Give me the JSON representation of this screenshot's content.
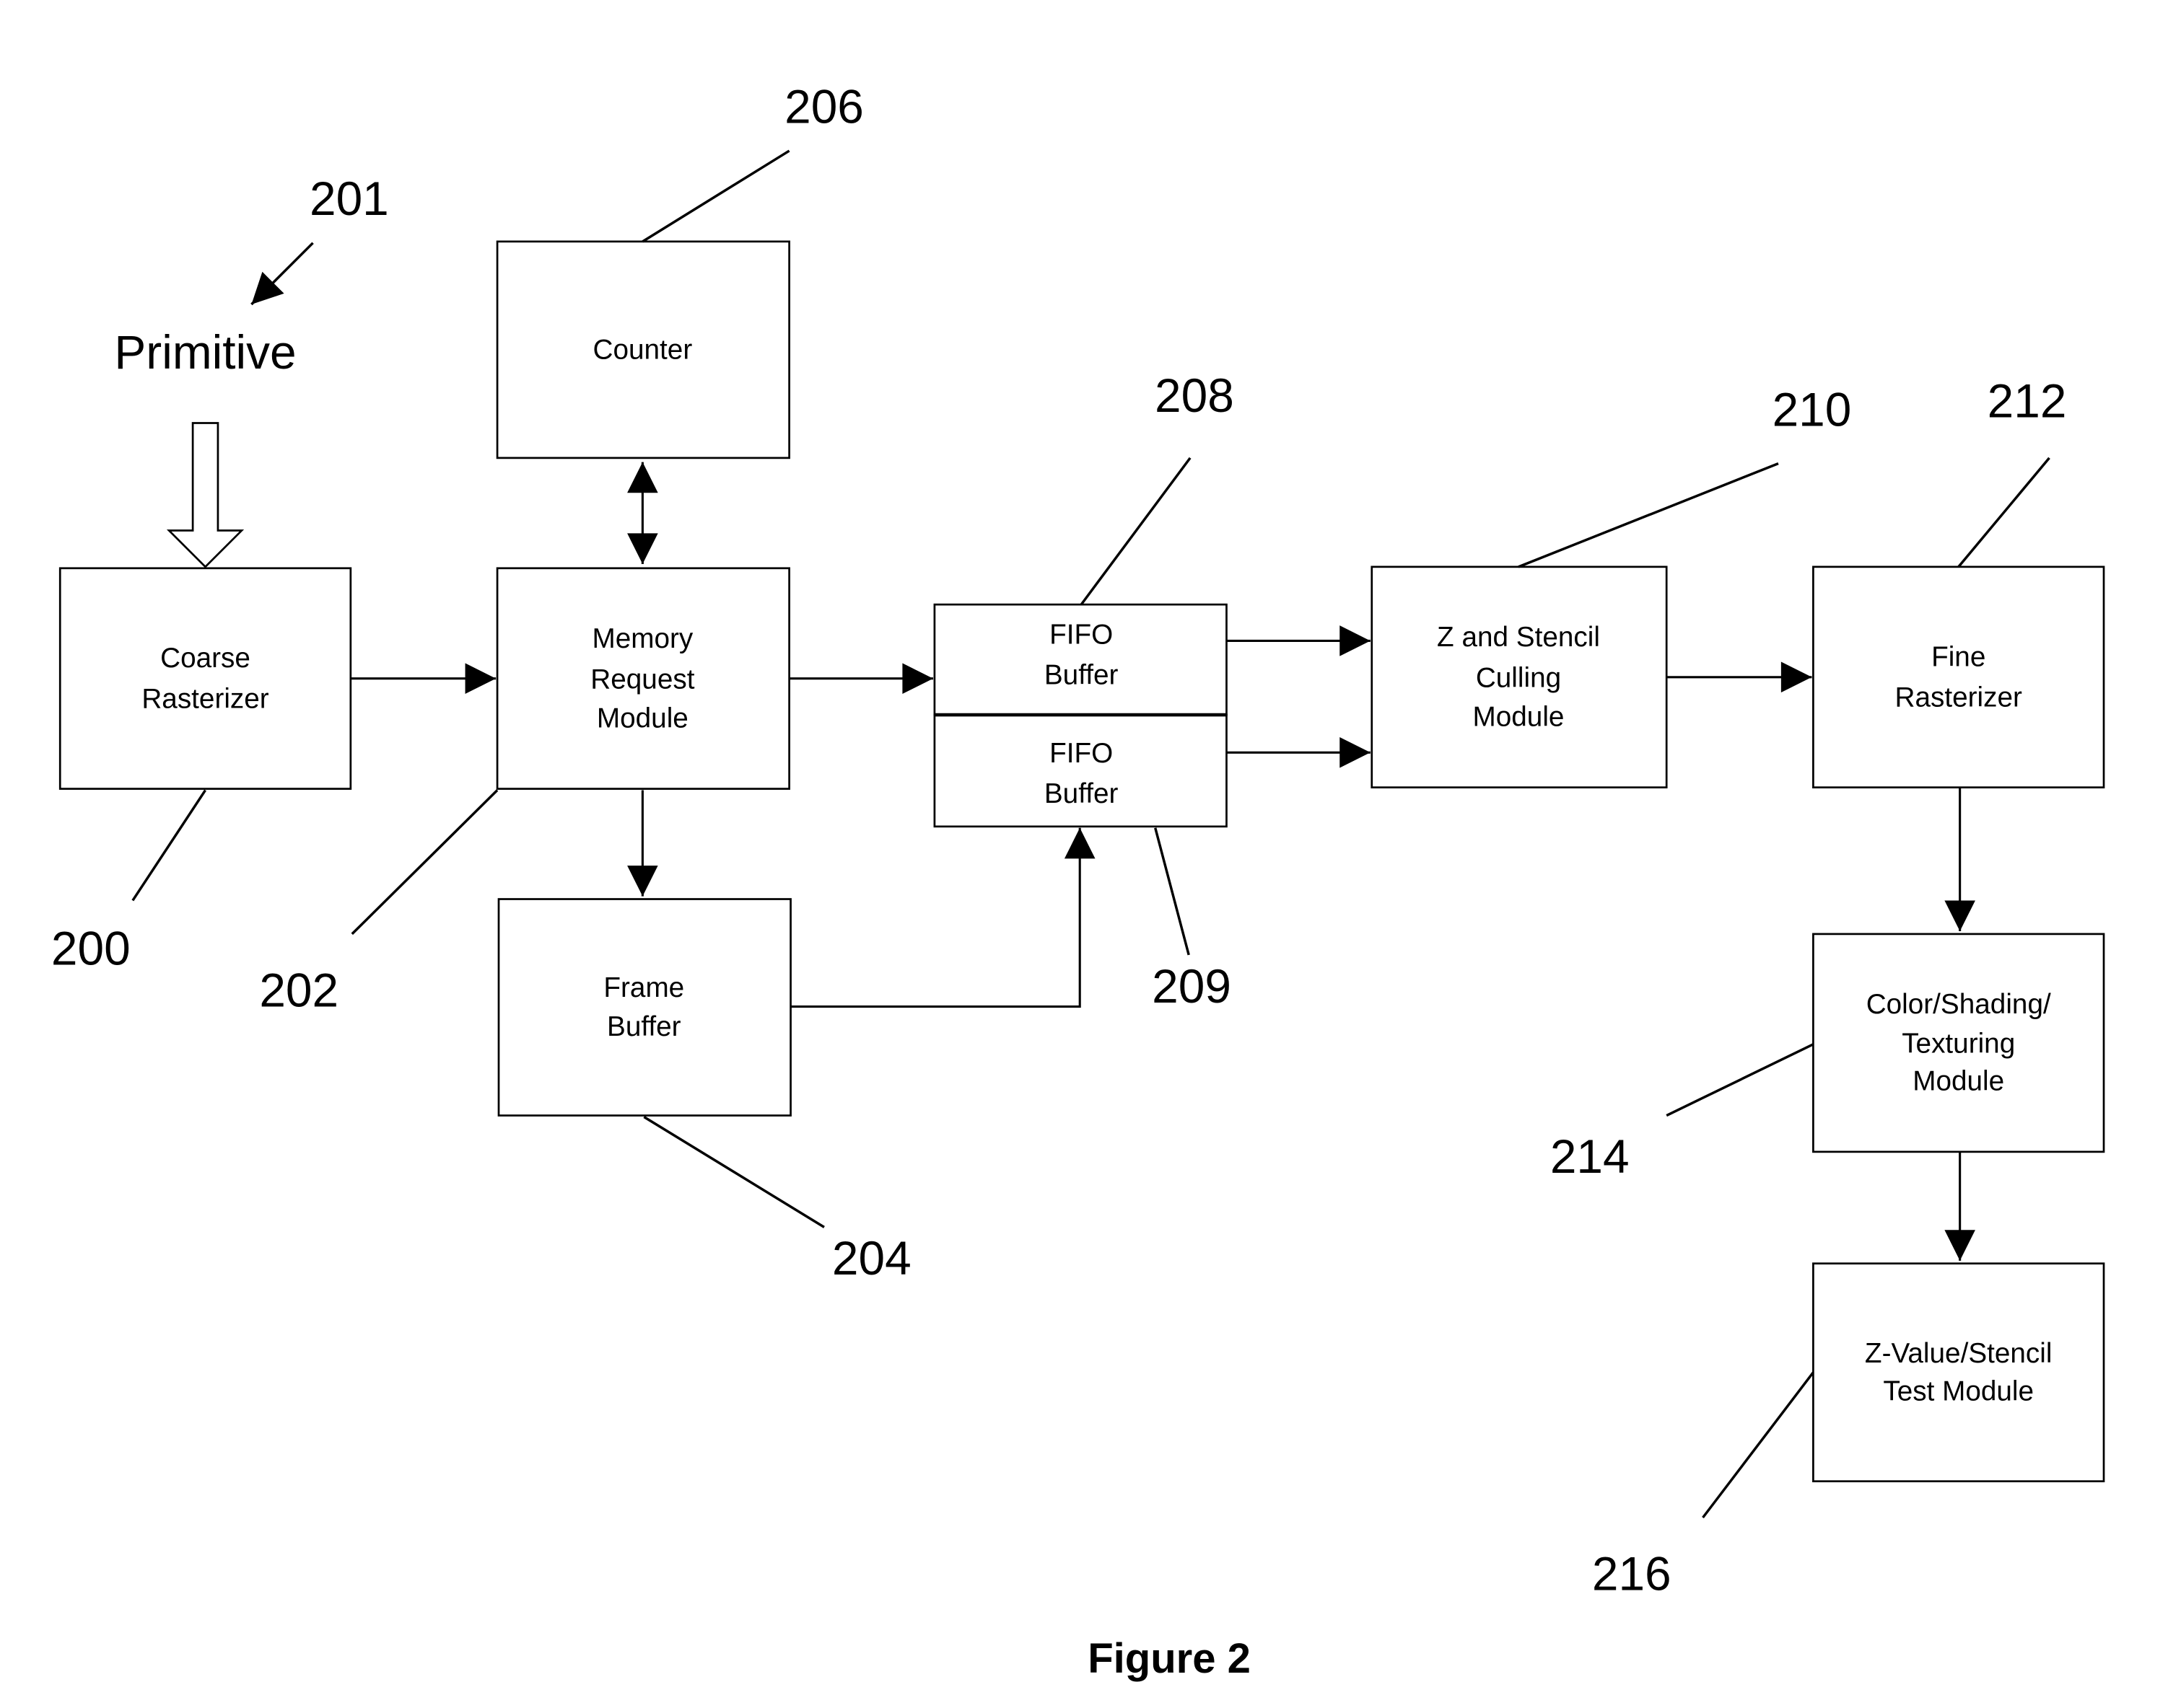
{
  "figure": {
    "caption": "Figure 2",
    "input_label": "Primitive",
    "input_ref": "201"
  },
  "blocks": {
    "coarse_rasterizer": {
      "lines": [
        "Coarse",
        "Rasterizer"
      ],
      "ref": "200"
    },
    "memory_request": {
      "lines": [
        "Memory",
        "Request",
        "Module"
      ],
      "ref": "202"
    },
    "counter": {
      "lines": [
        "Counter"
      ],
      "ref": "206"
    },
    "frame_buffer": {
      "lines": [
        "Frame",
        "Buffer"
      ],
      "ref": "204"
    },
    "fifo_top": {
      "lines": [
        "FIFO",
        "Buffer"
      ],
      "ref": "208"
    },
    "fifo_bottom": {
      "lines": [
        "FIFO",
        "Buffer"
      ],
      "ref": "209"
    },
    "z_stencil_culling": {
      "lines": [
        "Z and Stencil",
        "Culling",
        "Module"
      ],
      "ref": "210"
    },
    "fine_rasterizer": {
      "lines": [
        "Fine",
        "Rasterizer"
      ],
      "ref": "212"
    },
    "color_shading": {
      "lines": [
        "Color/Shading/",
        "Texturing",
        "Module"
      ],
      "ref": "214"
    },
    "z_value_stencil": {
      "lines": [
        "Z-Value/Stencil",
        "Test Module"
      ],
      "ref": "216"
    }
  }
}
